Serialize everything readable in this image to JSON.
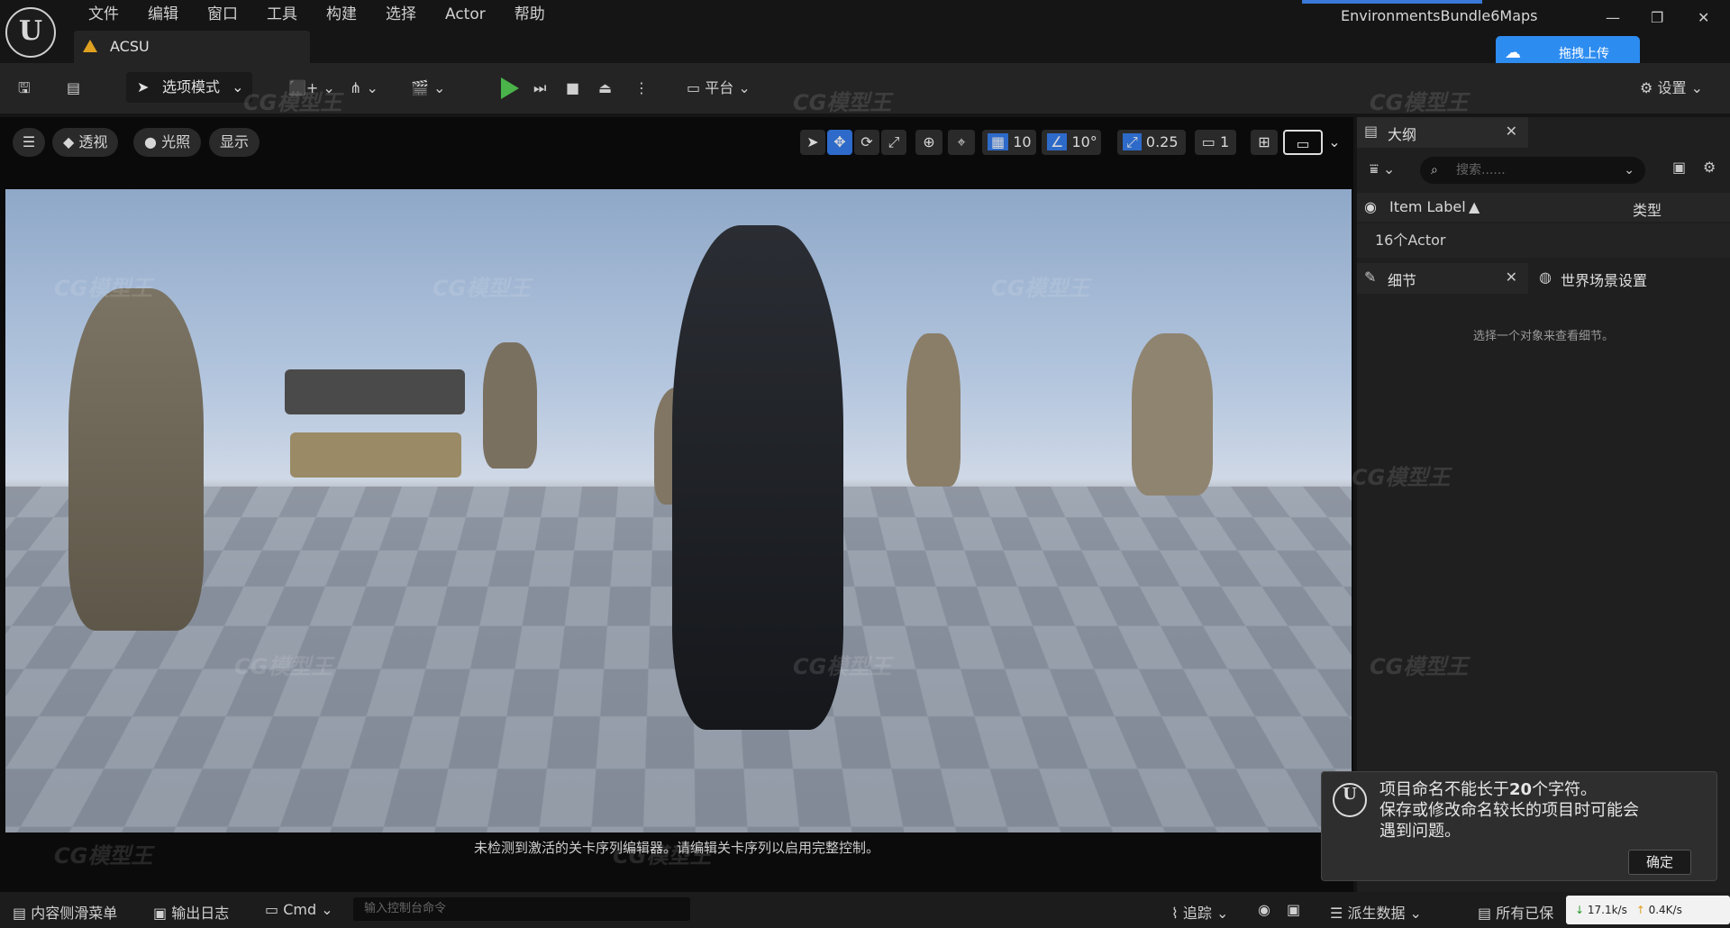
{
  "menu": [
    "文件",
    "编辑",
    "窗口",
    "工具",
    "构建",
    "选择",
    "Actor",
    "帮助"
  ],
  "tab_title": "ACSU",
  "project_name": "EnvironmentsBundle6Maps",
  "upload_label": "拖拽上传",
  "toolbar": {
    "mode_label": "选项模式",
    "platform_label": "平台",
    "settings_label": "设置"
  },
  "viewport": {
    "perspective_label": "透视",
    "lighting_label": "光照",
    "show_label": "显示",
    "grid_snap": "10",
    "rotation_snap": "10°",
    "scale_snap": "0.25",
    "camera_speed": "1",
    "message": "未检测到激活的关卡序列编辑器。请编辑关卡序列以启用完整控制。"
  },
  "outline": {
    "title": "大纲",
    "search_placeholder": "搜索......",
    "col_label": "Item Label",
    "col_type": "类型",
    "actor_count": "16个Actor"
  },
  "details": {
    "tab_label": "细节",
    "world_settings_label": "世界场景设置",
    "hint": "选择一个对象来查看细节。"
  },
  "toast": {
    "line1_prefix": "项目命名不能长于",
    "line1_num": "20",
    "line1_suffix": "个字符。",
    "line2": "保存或修改命名较长的项目时可能会",
    "line3": "遇到问题。",
    "ok": "确定"
  },
  "bottombar": {
    "content_drawer": "内容侧滑菜单",
    "output_log": "输出日志",
    "cmd": "Cmd",
    "console_placeholder": "输入控制台命令",
    "trace": "追踪",
    "derived_data": "派生数据",
    "all_saved": "所有已保",
    "down_speed": "17.1k/s",
    "up_speed": "0.4K/s"
  },
  "watermark": "CG模型王"
}
